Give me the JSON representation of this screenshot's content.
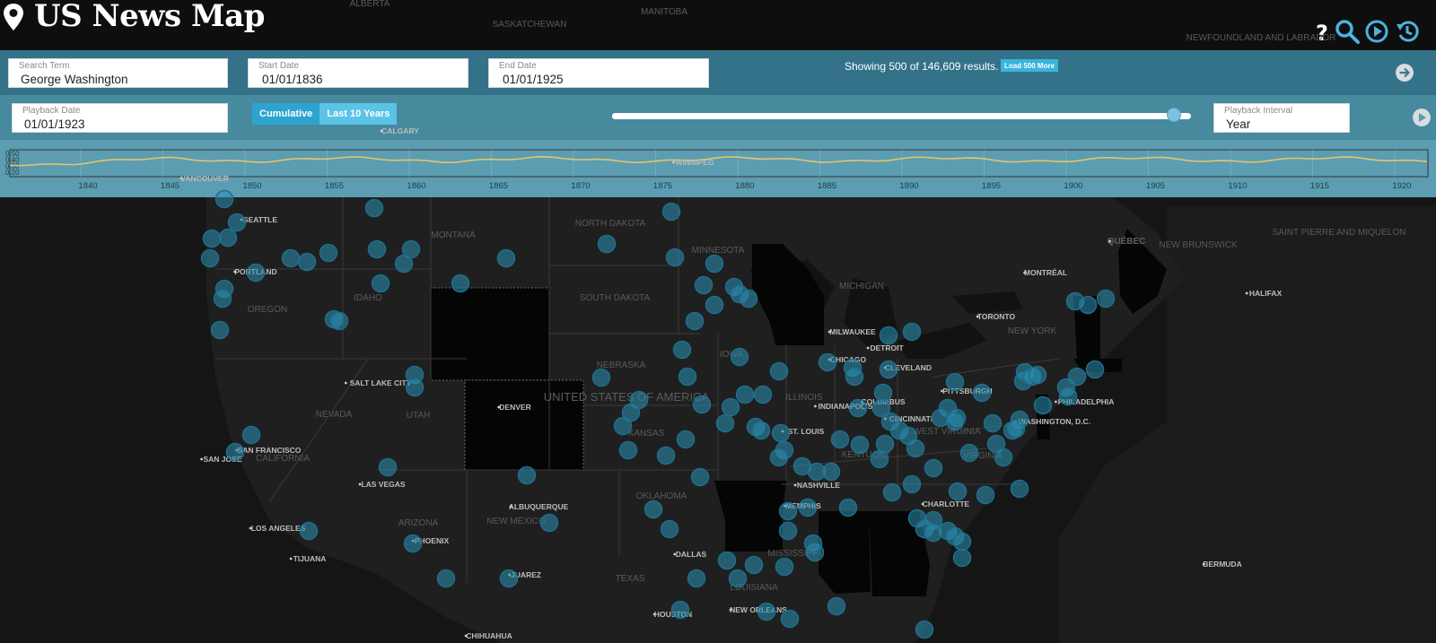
{
  "header": {
    "title": "US News Map",
    "icons": [
      "help-icon",
      "search-icon",
      "play-circle-icon",
      "history-icon"
    ]
  },
  "search": {
    "term_label": "Search Term",
    "term_value": "George Washington",
    "start_label": "Start Date",
    "start_value": "01/01/1836",
    "end_label": "End Date",
    "end_value": "01/01/1925",
    "results_text": "Showing 500 of 146,609 results.",
    "load_more_label": "Load 500 More"
  },
  "playback": {
    "date_label": "Playback Date",
    "date_value": "01/01/1923",
    "mode_cumulative": "Cumulative",
    "mode_last10": "Last 10 Years",
    "active_mode": "Cumulative",
    "slider_fraction": 0.97,
    "interval_label": "Playback Interval",
    "interval_value": "Year"
  },
  "timeline": {
    "y_ticks": [
      "0.50",
      "0.40",
      "0.30",
      "0.20"
    ],
    "x_ticks": [
      "1840",
      "1845",
      "1850",
      "1855",
      "1860",
      "1865",
      "1870",
      "1875",
      "1880",
      "1885",
      "1890",
      "1895",
      "1900",
      "1905",
      "1910",
      "1915",
      "1920"
    ],
    "line_color": "#e3c56c"
  },
  "map": {
    "states": [
      "MONTANA",
      "NORTH DAKOTA",
      "MINNESOTA",
      "SOUTH DAKOTA",
      "IDAHO",
      "OREGON",
      "NEBRASKA",
      "IOWA",
      "ILLINOIS",
      "KANSAS",
      "NEVADA",
      "UTAH",
      "CALIFORNIA",
      "ARIZONA",
      "NEW MEXICO",
      "OKLAHOMA",
      "TEXAS",
      "MICHIGAN",
      "NEW YORK",
      "LOUISIANA",
      "MISSISSIPPI",
      "WEST VIRGINIA",
      "KENTUCKY",
      "VIRGINIA"
    ],
    "cities": [
      "SEATTLE",
      "PORTLAND",
      "SALT LAKE CITY",
      "SAN FRANCISCO",
      "SAN JOSE",
      "LAS VEGAS",
      "LOS ANGELES",
      "TIJUANA",
      "PHOENIX",
      "ALBUQUERQUE",
      "JUAREZ",
      "CHIHUAHUA",
      "DALLAS",
      "HOUSTON",
      "NEW ORLEANS",
      "NASHVILLE",
      "MEMPHIS",
      "ST. LOUIS",
      "INDIANAPOLIS",
      "COLUMBUS",
      "CINCINNATI",
      "MILWAUKEE",
      "CHICAGO",
      "DETROIT",
      "CLEVELAND",
      "PITTSBURGH",
      "TORONTO",
      "MONTRÉAL",
      "QUÉBEC",
      "HALIFAX",
      "PHILADELPHIA",
      "WASHINGTON, D.C.",
      "CHARLOTTE",
      "BERMUDA",
      "CALGARY",
      "WINNIPEG",
      "VANCOUVER",
      "DENVER"
    ],
    "regions": [
      "ALBERTA",
      "SASKATCHEWAN",
      "MANITOBA",
      "QUÉBEC",
      "NEWFOUNDLAND AND LABRADOR",
      "NEW BRUNSWICK",
      "SAINT PIERRE AND MIQUELON",
      "UNITED STATES OF AMERICA"
    ],
    "marker_color": "#2a8fb4"
  }
}
